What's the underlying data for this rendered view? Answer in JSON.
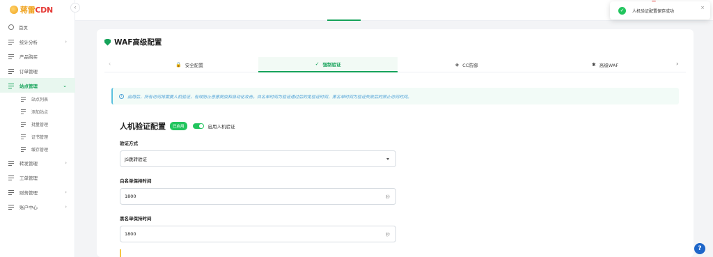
{
  "brand": {
    "name_part1": "蒋雷",
    "name_part2": "CDN"
  },
  "sidebar": {
    "collapse_glyph": "‹",
    "items": [
      {
        "label": "首页",
        "icon": "globe-icon"
      },
      {
        "label": "统计分析",
        "icon": "list-icon",
        "chevron": "›"
      },
      {
        "label": "产品购买",
        "icon": "list-icon"
      },
      {
        "label": "订单管理",
        "icon": "list-icon"
      },
      {
        "label": "站点管理",
        "icon": "list-icon",
        "chevron": "⌄",
        "active": true
      },
      {
        "label": "转发管理",
        "icon": "list-icon",
        "chevron": "›"
      },
      {
        "label": "工单管理",
        "icon": "list-icon"
      },
      {
        "label": "财务管理",
        "icon": "list-icon",
        "chevron": "›"
      },
      {
        "label": "账户中心",
        "icon": "list-icon",
        "chevron": "›"
      }
    ],
    "sub_items": [
      "站点列表",
      "添加站点",
      "批量管理",
      "证书管理",
      "缓存管理"
    ]
  },
  "toast": {
    "message": "人机验证配置保存成功",
    "close": "×",
    "icon": "check-circle-icon"
  },
  "page": {
    "title": "WAF高级配置",
    "tabs": [
      {
        "label": "安全配置",
        "icon": "lock-icon",
        "glyph": "🔒"
      },
      {
        "label": "强制验证",
        "icon": "shield-check-icon",
        "glyph": "✓",
        "active": true
      },
      {
        "label": "CC防御",
        "icon": "shield-icon",
        "glyph": "◈"
      },
      {
        "label": "高级WAF",
        "icon": "gear-icon",
        "glyph": "✱"
      }
    ],
    "tab_prev": "‹",
    "tab_next": "›",
    "alert": "启用后，所有访问将需要人机验证，有效防止恶意爬虫和自动化攻击。白名单时间为验证通过后的免验证时间，黑名单时间为验证失败后的禁止访问时间。",
    "section_title": "人机验证配置",
    "status_badge": "已启用",
    "toggle_label": "启用人机验证",
    "fields": {
      "method_label": "验证方式",
      "method_value": "JS跳转验证",
      "whitelist_label": "白名单保持时间",
      "whitelist_value": "1800",
      "whitelist_unit": "秒",
      "blacklist_label": "黑名单保持时间",
      "blacklist_value": "1800",
      "blacklist_unit": "秒"
    }
  },
  "help_glyph": "?",
  "colors": {
    "accent": "#16a35a",
    "info": "#4a9fd6",
    "help": "#1e66c9"
  }
}
